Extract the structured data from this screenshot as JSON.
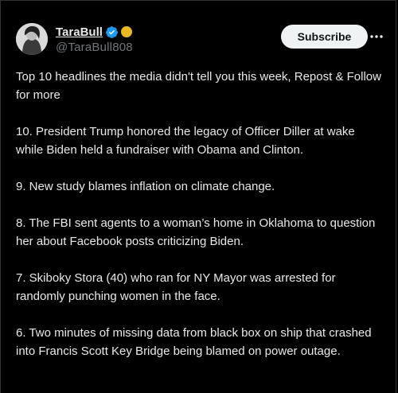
{
  "author": {
    "display_name": "TaraBull",
    "handle": "@TaraBull808",
    "verified_color": "#1d9bf0",
    "badge_color": "#e8b923"
  },
  "actions": {
    "subscribe_label": "Subscribe",
    "more_icon": "more-horizontal-icon"
  },
  "tweet": {
    "paragraphs": [
      "Top 10 headlines the media didn't tell you this week, Repost & Follow for more",
      "10. President Trump honored the legacy of Officer Diller at wake while Biden held a fundraiser with Obama and Clinton.",
      "9. New study blames inflation on climate change.",
      "8. The FBI sent agents to a woman’s home in Oklahoma to question her about Facebook posts criticizing Biden.",
      "7. Skiboky Stora (40) who ran for NY Mayor was arrested for randomly punching women in the face.",
      "6. Two minutes of missing data from black box on ship that crashed into Francis Scott Key Bridge being blamed on power outage."
    ]
  }
}
